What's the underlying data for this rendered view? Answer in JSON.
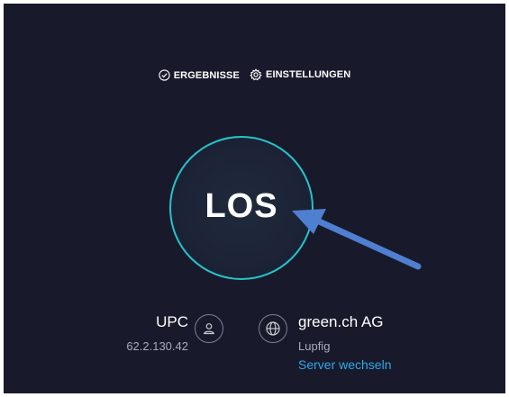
{
  "nav": {
    "results_label": "ERGEBNISSE",
    "settings_label": "EINSTELLUNGEN",
    "results_icon": "check-circle-icon",
    "settings_icon": "gear-icon"
  },
  "go_button": {
    "label": "LOS"
  },
  "isp": {
    "name": "UPC",
    "ip": "62.2.130.42",
    "icon": "user-icon"
  },
  "server": {
    "name": "green.ch AG",
    "location": "Lupfig",
    "change_label": "Server wechseln",
    "icon": "globe-icon"
  },
  "colors": {
    "background": "#181a2b",
    "ring": "#27c3c9",
    "link": "#2fa8e8",
    "annotation_arrow": "#4f7fd0"
  }
}
